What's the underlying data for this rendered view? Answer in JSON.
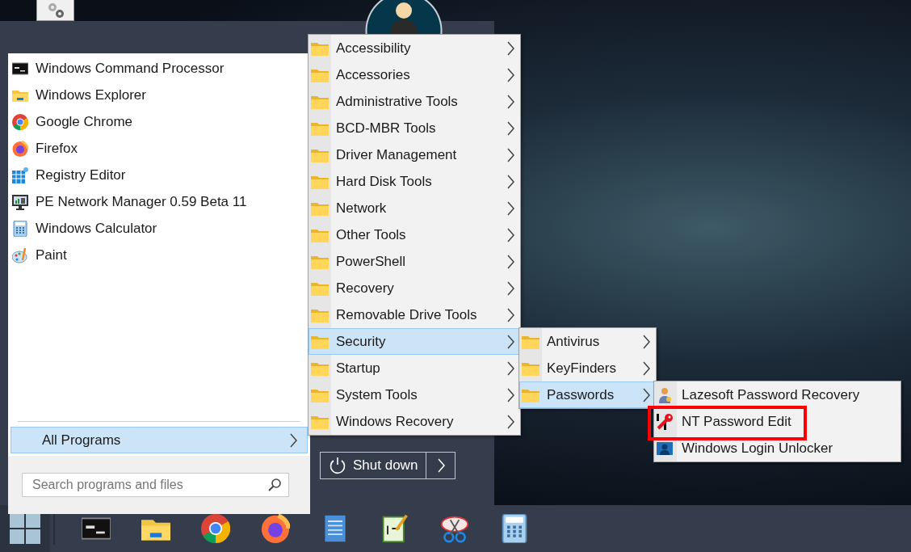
{
  "start_menu": {
    "programs": [
      {
        "label": "Windows Command Processor"
      },
      {
        "label": "Windows Explorer"
      },
      {
        "label": "Google Chrome"
      },
      {
        "label": "Firefox"
      },
      {
        "label": "Registry Editor"
      },
      {
        "label": "PE Network Manager 0.59 Beta 11"
      },
      {
        "label": "Windows Calculator"
      },
      {
        "label": "Paint"
      }
    ],
    "all_programs": {
      "label": "All Programs",
      "selected": true
    },
    "search": {
      "placeholder": "Search programs and files"
    },
    "shutdown": {
      "label": "Shut down"
    }
  },
  "all_programs_menu": [
    {
      "label": "Accessibility",
      "selected": false
    },
    {
      "label": "Accessories",
      "selected": false
    },
    {
      "label": "Administrative Tools",
      "selected": false
    },
    {
      "label": "BCD-MBR Tools",
      "selected": false
    },
    {
      "label": "Driver Management",
      "selected": false
    },
    {
      "label": "Hard Disk Tools",
      "selected": false
    },
    {
      "label": "Network",
      "selected": false
    },
    {
      "label": "Other Tools",
      "selected": false
    },
    {
      "label": "PowerShell",
      "selected": false
    },
    {
      "label": "Recovery",
      "selected": false
    },
    {
      "label": "Removable Drive Tools",
      "selected": false
    },
    {
      "label": "Security",
      "selected": true
    },
    {
      "label": "Startup",
      "selected": false
    },
    {
      "label": "System Tools",
      "selected": false
    },
    {
      "label": "Windows Recovery",
      "selected": false
    }
  ],
  "security_menu": [
    {
      "label": "Antivirus",
      "selected": false
    },
    {
      "label": "KeyFinders",
      "selected": false
    },
    {
      "label": "Passwords",
      "selected": true
    }
  ],
  "passwords_menu": [
    {
      "label": "Lazesoft Password Recovery",
      "highlighted": false
    },
    {
      "label": "NT Password Edit",
      "highlighted": true
    },
    {
      "label": "Windows Login Unlocker",
      "highlighted": false
    }
  ]
}
